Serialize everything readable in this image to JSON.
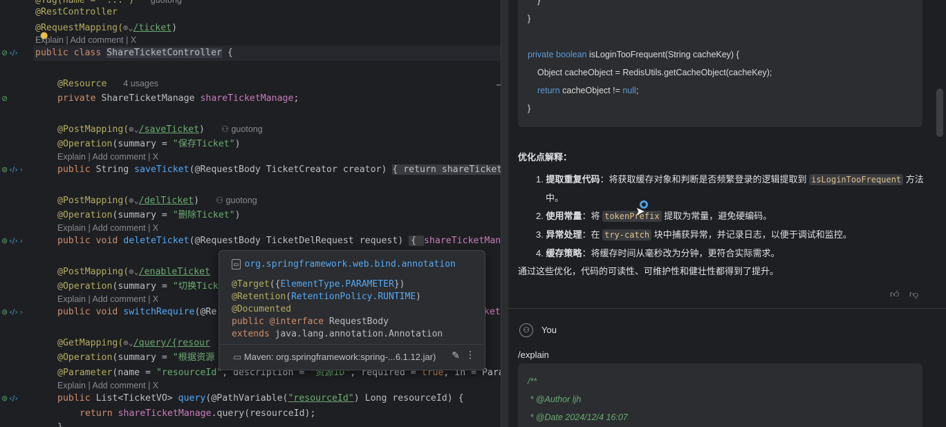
{
  "editor": {
    "lines": {
      "l0": "@Tag(name = \"...\")",
      "author0": "guotong",
      "rest": "@RestController",
      "rm_ann": "@RequestMapping(",
      "rm_url": "/ticket",
      "rm_close": ")",
      "hint1": "Explain | Add comment | X",
      "class_kw": "public class ",
      "class_name": "ShareTicketController",
      "class_brace": " {",
      "res_ann": "@Resource",
      "res_usage": "4 usages",
      "res_field_kw": "private ",
      "res_field_type": "ShareTicketManage ",
      "res_field_name": "shareTicketManage",
      "res_semicolon": ";",
      "pm1_ann": "@PostMapping(",
      "pm1_url": "/saveTicket",
      "pm1_close": ")",
      "pm1_author": "guotong",
      "op1_ann": "@Operation",
      "op1_args": "(summary = ",
      "op1_str": "\"保存Ticket\"",
      "op1_close": ")",
      "hint2": "Explain | Add comment | X",
      "save_kw": "public ",
      "save_type": "String ",
      "save_fn": "saveTicket",
      "save_args": "(@RequestBody TicketCreator creator) ",
      "save_fold": "{ return shareTicketM",
      "pm2_ann": "@PostMapping(",
      "pm2_url": "/delTicket",
      "pm2_close": ")",
      "pm2_author": "guotong",
      "op2_ann": "@Operation",
      "op2_args": "(summary = ",
      "op2_str": "\"删除Ticket\"",
      "op2_close": ")",
      "hint3": "Explain | Add comment | X",
      "del_kw": "public void ",
      "del_fn": "deleteTicket",
      "del_args": "(@RequestBody TicketDelRequest request) ",
      "del_fold": "{ ",
      "del_tail": "shareTicketManag",
      "pm3_ann": "@PostMapping(",
      "pm3_url": "/enableTicket",
      "op3_ann": "@Operation",
      "op3_args": "(summary = ",
      "op3_str": "\"切换Tick",
      "hint4": "Explain | Add comment | X",
      "sw_kw": "public void ",
      "sw_fn": "switchRequire",
      "sw_args": "(@Re",
      "sw_tail": "ket",
      "gm_ann": "@GetMapping(",
      "gm_url": "/query/{resour",
      "op4_ann": "@Operation",
      "op4_args": "(summary = ",
      "op4_str": "\"根据资源",
      "param_ann": "@Parameter",
      "param_args1": "(name = ",
      "param_str1": "\"resourceId\"",
      "param_args2": ", description = ",
      "param_str2": "\"资源ID\"",
      "param_args3": ", required = ",
      "param_true": "true",
      "param_args4": ", in = Para",
      "hint5": "Explain | Add comment | X",
      "q_kw": "public ",
      "q_type": "List<TicketVO> ",
      "q_fn": "query",
      "q_args1": "(@PathVariable(",
      "q_str": "\"resourceId\"",
      "q_args2": ") Long resourceId) {",
      "ret_kw": "return ",
      "ret_field": "shareTicketManage",
      "ret_rest": ".query(resourceId);",
      "last": "}"
    }
  },
  "popup": {
    "package": "org.springframework.web.bind.annotation",
    "target_ann": "@Target",
    "target_val": "ElementType.PARAMETER",
    "retention_ann": "@Retention",
    "retention_val": "RetentionPolicy.RUNTIME",
    "documented": "@Documented",
    "decl_kw": "public ",
    "decl_at": "@interface ",
    "decl_name": "RequestBody",
    "extends_kw": "extends ",
    "extends_name": "java.lang.annotation.Annotation",
    "maven": "Maven: org.springframework:spring-...6.1.12.jar)"
  },
  "chat": {
    "code1": {
      "l1": "}",
      "l2": "}",
      "l3_kw": "private boolean ",
      "l3_fn": "isLoginTooFrequent",
      "l3_rest": "(String cacheKey) {",
      "l4": "Object cacheObject = RedisUtils.getCacheObject(cacheKey);",
      "l5_kw": "return ",
      "l5_mid": "cacheObject != ",
      "l5_null": "null",
      "l5_end": ";",
      "l6": "}"
    },
    "section_title": "优化点解释：",
    "items": [
      {
        "num": "1.",
        "bold": "提取重复代码",
        "pre": "：将获取缓存对象和判断是否频繁登录的逻辑提取到 ",
        "code": "isLoginTooFrequent",
        "post": " 方法",
        "cont": "中。"
      },
      {
        "num": "2.",
        "bold": "使用常量",
        "pre": "：将 ",
        "code": "tokenPrefix",
        "post": " 提取为常量，避免硬编码。"
      },
      {
        "num": "3.",
        "bold": "异常处理",
        "pre": "：在 ",
        "code": "try-catch",
        "post": " 块中捕获异常，并记录日志，以便于调试和监控。"
      },
      {
        "num": "4.",
        "bold": "缓存策略",
        "pre": "：将缓存时间从毫秒改为分钟，更符合实际需求。"
      }
    ],
    "summary": "通过这些优化，代码的可读性、可维护性和健壮性都得到了提升。",
    "user_name": "You",
    "user_command": "/explain",
    "code2": {
      "c1": "/**",
      "c2": " * @Author ljh",
      "c3": " * @Date 2024/12/4 16:07"
    }
  }
}
